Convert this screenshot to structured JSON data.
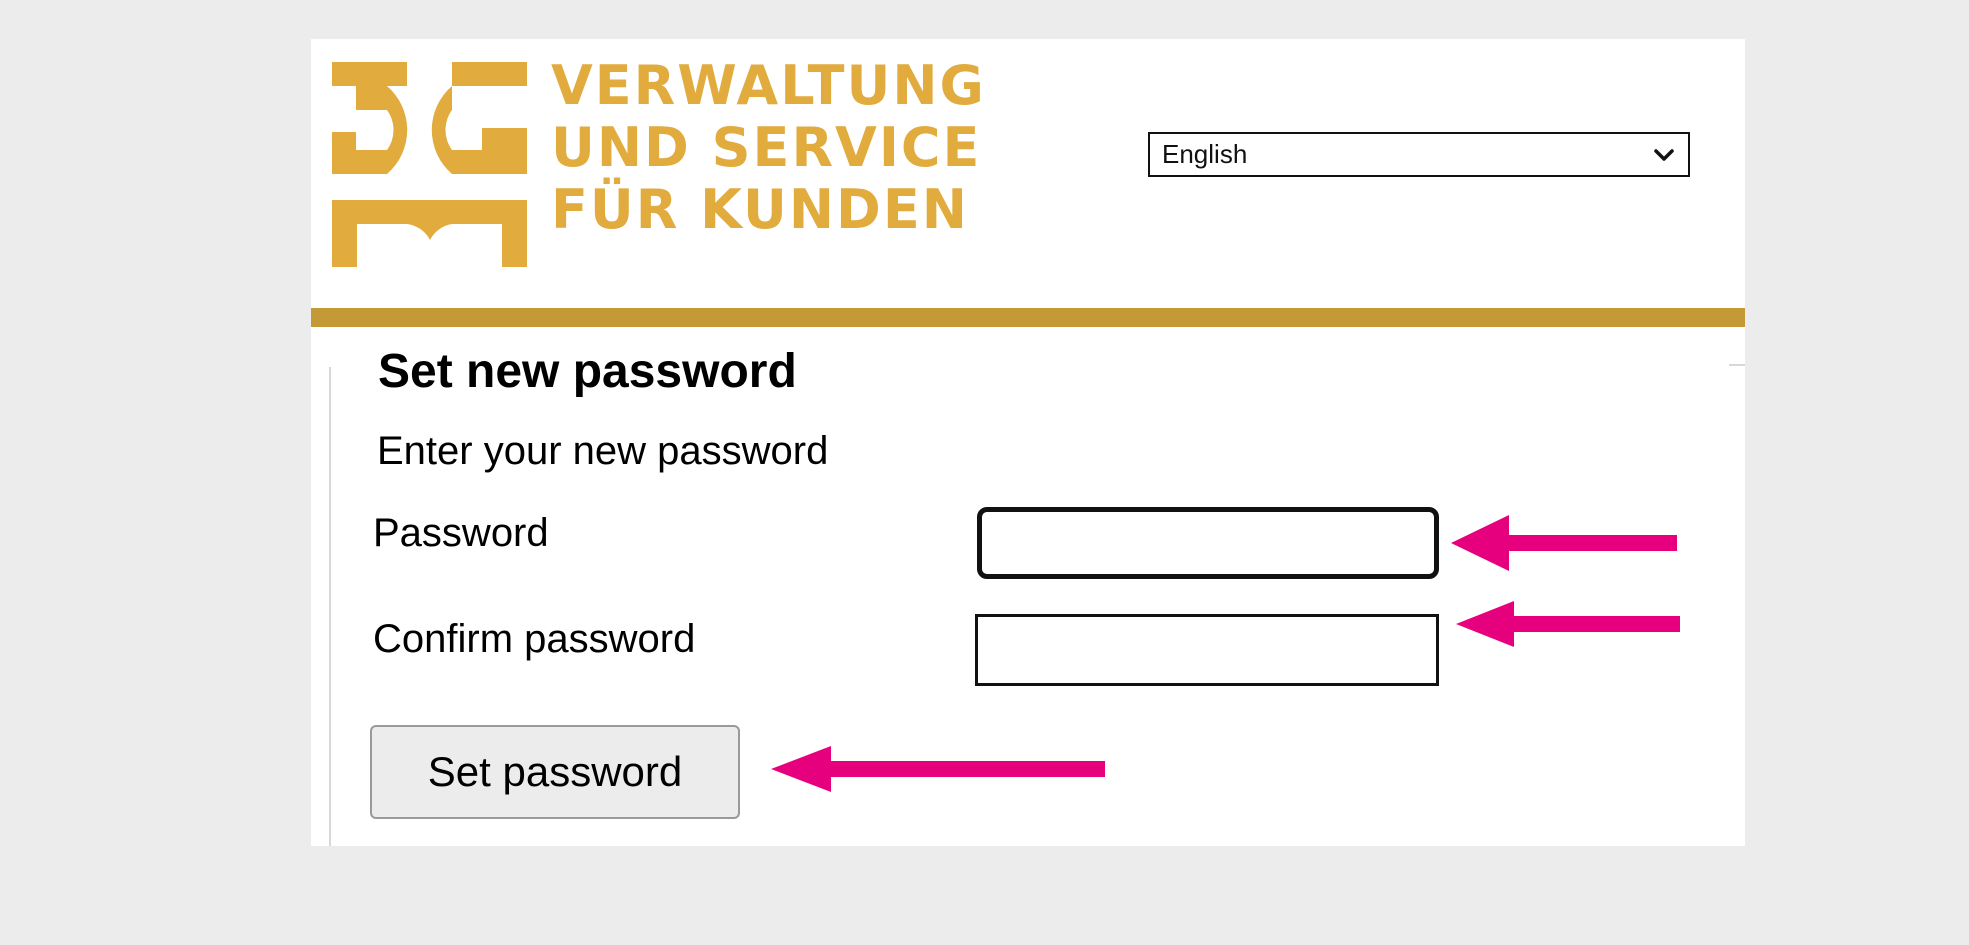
{
  "header": {
    "logo_lines": [
      "VERWALTUNG",
      "UND SERVICE",
      "FÜR KUNDEN"
    ],
    "language_select": {
      "selected": "English"
    },
    "brand_color": "#e1ab3d",
    "bar_color": "#c49a36"
  },
  "form": {
    "title": "Set new password",
    "subtitle": "Enter your new password",
    "password_label": "Password",
    "confirm_label": "Confirm password",
    "password_value": "",
    "confirm_value": "",
    "submit_label": "Set password"
  },
  "annotations": {
    "arrow_color": "#e6007e",
    "icon": "arrow-left-icon"
  }
}
